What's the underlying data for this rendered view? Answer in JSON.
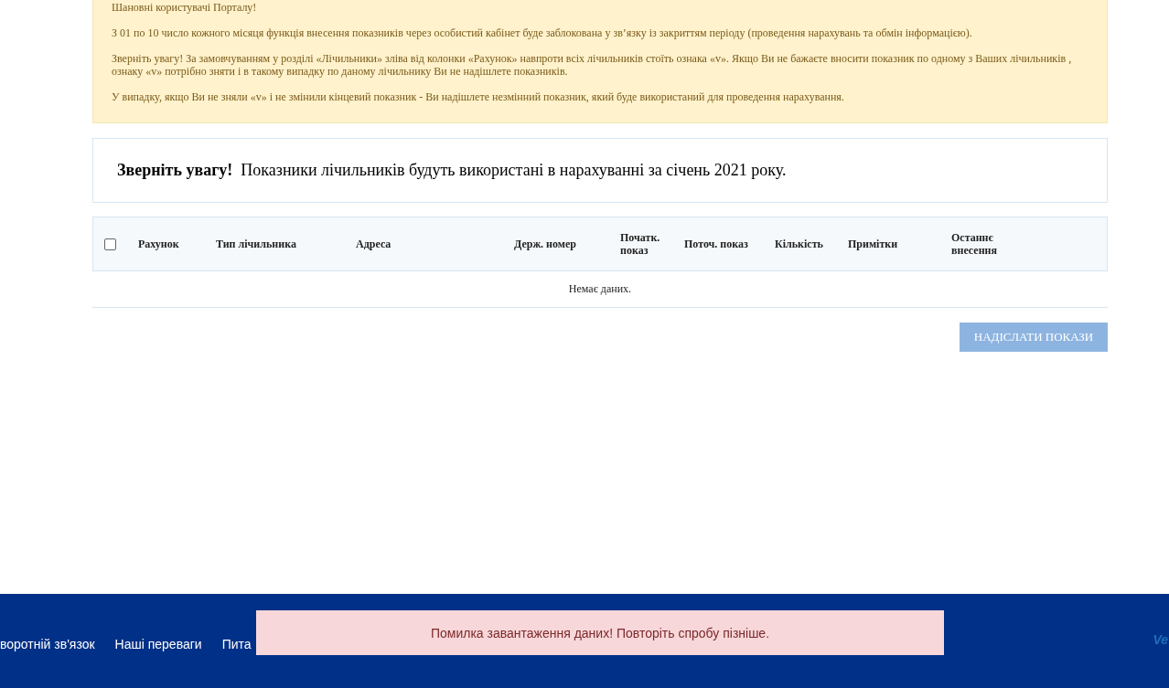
{
  "notice": {
    "paragraphs": [
      [
        "Шановні користувачі Порталу!"
      ],
      [
        "З 01 по 10 число кожного місяця функція внесення показників через особистий кабінет буде заблокована у зв’язку із закриттям періоду (проведення нарахувань та обмін інформацією)."
      ],
      [
        "Зверніть увагу!  За замовчуванням у розділі «Лічильники» зліва від колонки «Рахунок» навпроти всіх лічильників стоїть ознака «v». Якщо Ви не бажаєте вносити показник по одному з Ваших лічильників ,",
        "ознаку «v» потрібно зняти і в такому випадку по даному лічильнику Ви не надішлете показників."
      ],
      [
        "У випадку, якщо Ви не зняли «v» і не змінили кінцевий показник  - Ви надішлете незмінний показник, який буде використаний  для проведення нарахування."
      ]
    ]
  },
  "attention": {
    "text": "**Зверніть увагу!**  Показники лічильників будуть використані в нарахуванні за січень 2021 року."
  },
  "table": {
    "select_all": {
      "checked": false
    },
    "columns": [
      [
        "Рахунок"
      ],
      [
        "Тип лічильника"
      ],
      [
        "Адреса"
      ],
      [
        "Держ. номер"
      ],
      [
        "Початк.",
        "показ"
      ],
      [
        "Поточ. показ"
      ],
      [
        "Кількість"
      ],
      [
        "Примітки"
      ],
      [
        "Останнє",
        "внесення"
      ]
    ],
    "empty_text": "Немає даних."
  },
  "submit_button": {
    "label": "НАДІСЛАТИ ПОКАЗИ",
    "disabled": true
  },
  "footer": {
    "links": [
      "воротній зв'язок",
      "Наші переваги",
      "Пита"
    ],
    "logo": "Ve"
  },
  "toast": {
    "message": "Помилка завантаження даних! Повторіть спробу пізніше."
  }
}
